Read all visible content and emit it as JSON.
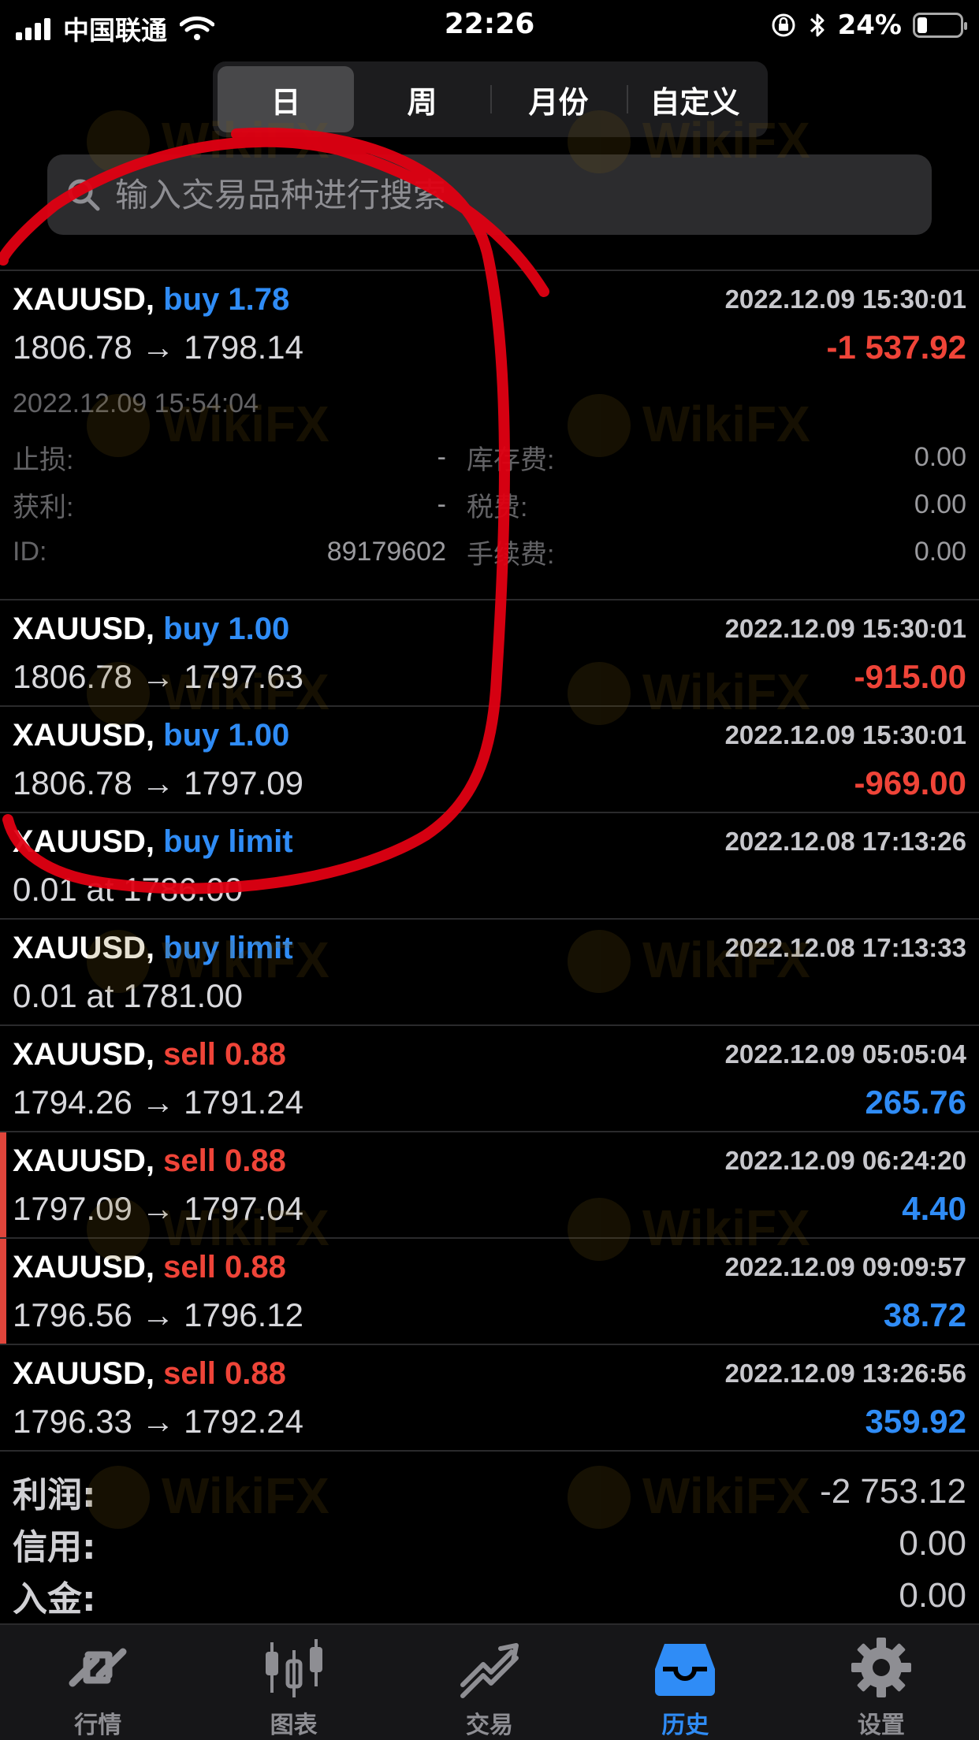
{
  "status_bar": {
    "carrier": "中国联通",
    "time": "22:26",
    "battery": "24%",
    "battery_level": 0.24
  },
  "segments": [
    {
      "label": "日",
      "active": true
    },
    {
      "label": "周",
      "active": false
    },
    {
      "label": "月份",
      "active": false
    },
    {
      "label": "自定义",
      "active": false
    }
  ],
  "search": {
    "placeholder": "输入交易品种进行搜索"
  },
  "deals": [
    {
      "symbol": "XAUUSD,",
      "action": "buy 1.78",
      "side": "buy",
      "datetime": "2022.12.09 15:30:01",
      "prices": "1806.78 → 1798.14",
      "profit": "-1 537.92",
      "profit_sign": "neg",
      "marker": false,
      "details": {
        "close_time": "2022.12.09 15:54:04",
        "rows": [
          {
            "l1": "止损:",
            "v1": "-",
            "l2": "库存费:",
            "v2": "0.00"
          },
          {
            "l1": "获利:",
            "v1": "-",
            "l2": "税费:",
            "v2": "0.00"
          },
          {
            "l1": "ID:",
            "v1": "89179602",
            "l2": "手续费:",
            "v2": "0.00"
          }
        ]
      }
    },
    {
      "symbol": "XAUUSD,",
      "action": "buy 1.00",
      "side": "buy",
      "datetime": "2022.12.09 15:30:01",
      "prices": "1806.78 → 1797.63",
      "profit": "-915.00",
      "profit_sign": "neg",
      "marker": false
    },
    {
      "symbol": "XAUUSD,",
      "action": "buy 1.00",
      "side": "buy",
      "datetime": "2022.12.09 15:30:01",
      "prices": "1806.78 → 1797.09",
      "profit": "-969.00",
      "profit_sign": "neg",
      "marker": false
    },
    {
      "symbol": "XAUUSD,",
      "action": "buy limit",
      "side": "buy",
      "datetime": "2022.12.08 17:13:26",
      "prices": "0.01 at 1786.00",
      "profit": "",
      "profit_sign": "",
      "marker": false
    },
    {
      "symbol": "XAUUSD,",
      "action": "buy limit",
      "side": "buy",
      "datetime": "2022.12.08 17:13:33",
      "prices": "0.01 at 1781.00",
      "profit": "",
      "profit_sign": "",
      "marker": false
    },
    {
      "symbol": "XAUUSD,",
      "action": "sell 0.88",
      "side": "sell",
      "datetime": "2022.12.09 05:05:04",
      "prices": "1794.26 → 1791.24",
      "profit": "265.76",
      "profit_sign": "pos",
      "marker": false
    },
    {
      "symbol": "XAUUSD,",
      "action": "sell 0.88",
      "side": "sell",
      "datetime": "2022.12.09 06:24:20",
      "prices": "1797.09 → 1797.04",
      "profit": "4.40",
      "profit_sign": "pos",
      "marker": true
    },
    {
      "symbol": "XAUUSD,",
      "action": "sell 0.88",
      "side": "sell",
      "datetime": "2022.12.09 09:09:57",
      "prices": "1796.56 → 1796.12",
      "profit": "38.72",
      "profit_sign": "pos",
      "marker": true
    },
    {
      "symbol": "XAUUSD,",
      "action": "sell 0.88",
      "side": "sell",
      "datetime": "2022.12.09 13:26:56",
      "prices": "1796.33 → 1792.24",
      "profit": "359.92",
      "profit_sign": "pos",
      "marker": false
    }
  ],
  "summary": [
    {
      "label": "利润:",
      "value": "-2 753.12"
    },
    {
      "label": "信用:",
      "value": "0.00"
    },
    {
      "label": "入金:",
      "value": "0.00"
    }
  ],
  "tabs": [
    {
      "label": "行情",
      "icon": "quotes-icon",
      "active": false
    },
    {
      "label": "图表",
      "icon": "chart-icon",
      "active": false
    },
    {
      "label": "交易",
      "icon": "trade-icon",
      "active": false
    },
    {
      "label": "历史",
      "icon": "history-icon",
      "active": true
    },
    {
      "label": "设置",
      "icon": "settings-icon",
      "active": false
    }
  ],
  "colors": {
    "buy": "#2f8cf6",
    "sell": "#ef4438",
    "accent": "#2f8cf6",
    "annotation": "#e00012"
  },
  "watermark": "WikiFX"
}
